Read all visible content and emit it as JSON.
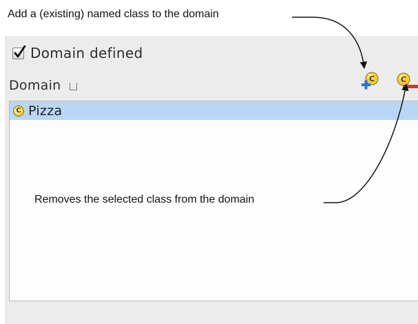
{
  "callouts": {
    "add": "Add a (existing) named class to the domain",
    "remove": "Removes the selected class from the domain"
  },
  "domain_defined": {
    "label": "Domain defined",
    "checked": true
  },
  "domain_section": {
    "title": "Domain",
    "tools": [
      "add-class-icon",
      "remove-class-icon"
    ]
  },
  "classes": [
    {
      "label": "Pizza",
      "badge": "C",
      "selected": true
    }
  ],
  "colors": {
    "selection": "#b9d7f4",
    "panel": "#ececec",
    "class_badge": "#f2cd3a",
    "add_plus": "#2f6fd6",
    "remove_minus": "#cc3b21"
  }
}
